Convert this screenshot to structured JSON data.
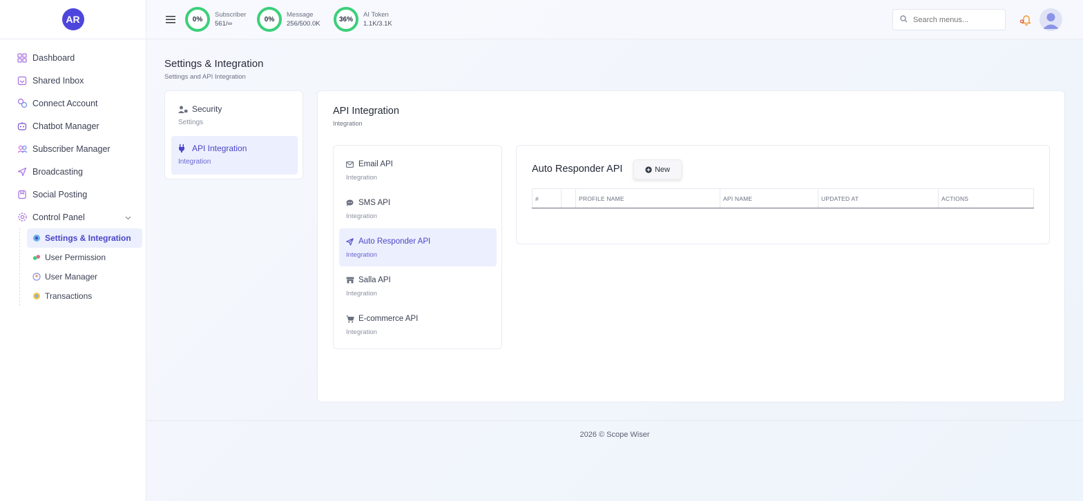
{
  "brand": {
    "initials": "AR"
  },
  "sidebar": {
    "items": [
      {
        "label": "Dashboard",
        "icon": "grid-icon"
      },
      {
        "label": "Shared Inbox",
        "icon": "inbox-icon"
      },
      {
        "label": "Connect Account",
        "icon": "link-icon"
      },
      {
        "label": "Chatbot Manager",
        "icon": "bot-icon"
      },
      {
        "label": "Subscriber Manager",
        "icon": "users-icon"
      },
      {
        "label": "Broadcasting",
        "icon": "send-icon"
      },
      {
        "label": "Social Posting",
        "icon": "bookmark-icon"
      },
      {
        "label": "Control Panel",
        "icon": "gear-icon"
      }
    ],
    "subitems": [
      {
        "label": "Settings & Integration",
        "icon": "settings-icon"
      },
      {
        "label": "User Permission",
        "icon": "permission-icon"
      },
      {
        "label": "User Manager",
        "icon": "user-manager-icon"
      },
      {
        "label": "Transactions",
        "icon": "transactions-icon"
      }
    ]
  },
  "topbar": {
    "meters": [
      {
        "percent": "0%",
        "label": "Subscriber",
        "value": "561/∞"
      },
      {
        "percent": "0%",
        "label": "Message",
        "value": "256/500.0K"
      },
      {
        "percent": "36%",
        "label": "AI Token",
        "value": "1.1K/3.1K"
      }
    ],
    "search_placeholder": "Search menus..."
  },
  "page": {
    "title": "Settings & Integration",
    "subtitle": "Settings and API Integration"
  },
  "left_menu": [
    {
      "title": "Security",
      "subtitle": "Settings"
    },
    {
      "title": "API Integration",
      "subtitle": "Integration"
    }
  ],
  "main": {
    "title": "API Integration",
    "subtitle": "Integration",
    "apis": [
      {
        "title": "Email API",
        "subtitle": "Integration"
      },
      {
        "title": "SMS API",
        "subtitle": "Integration"
      },
      {
        "title": "Auto Responder API",
        "subtitle": "Integration"
      },
      {
        "title": "Salla API",
        "subtitle": "Integration"
      },
      {
        "title": "E-commerce API",
        "subtitle": "Integration"
      }
    ],
    "detail": {
      "title": "Auto Responder API",
      "new_label": "New",
      "columns": [
        "#",
        "",
        "PROFILE NAME",
        "API NAME",
        "UPDATED AT",
        "ACTIONS"
      ]
    }
  },
  "footer": {
    "text": "2026 © Scope Wiser"
  },
  "colors": {
    "accent": "#4e46dc",
    "meter": "#3ccf7a",
    "active_bg": "#eceffd"
  }
}
